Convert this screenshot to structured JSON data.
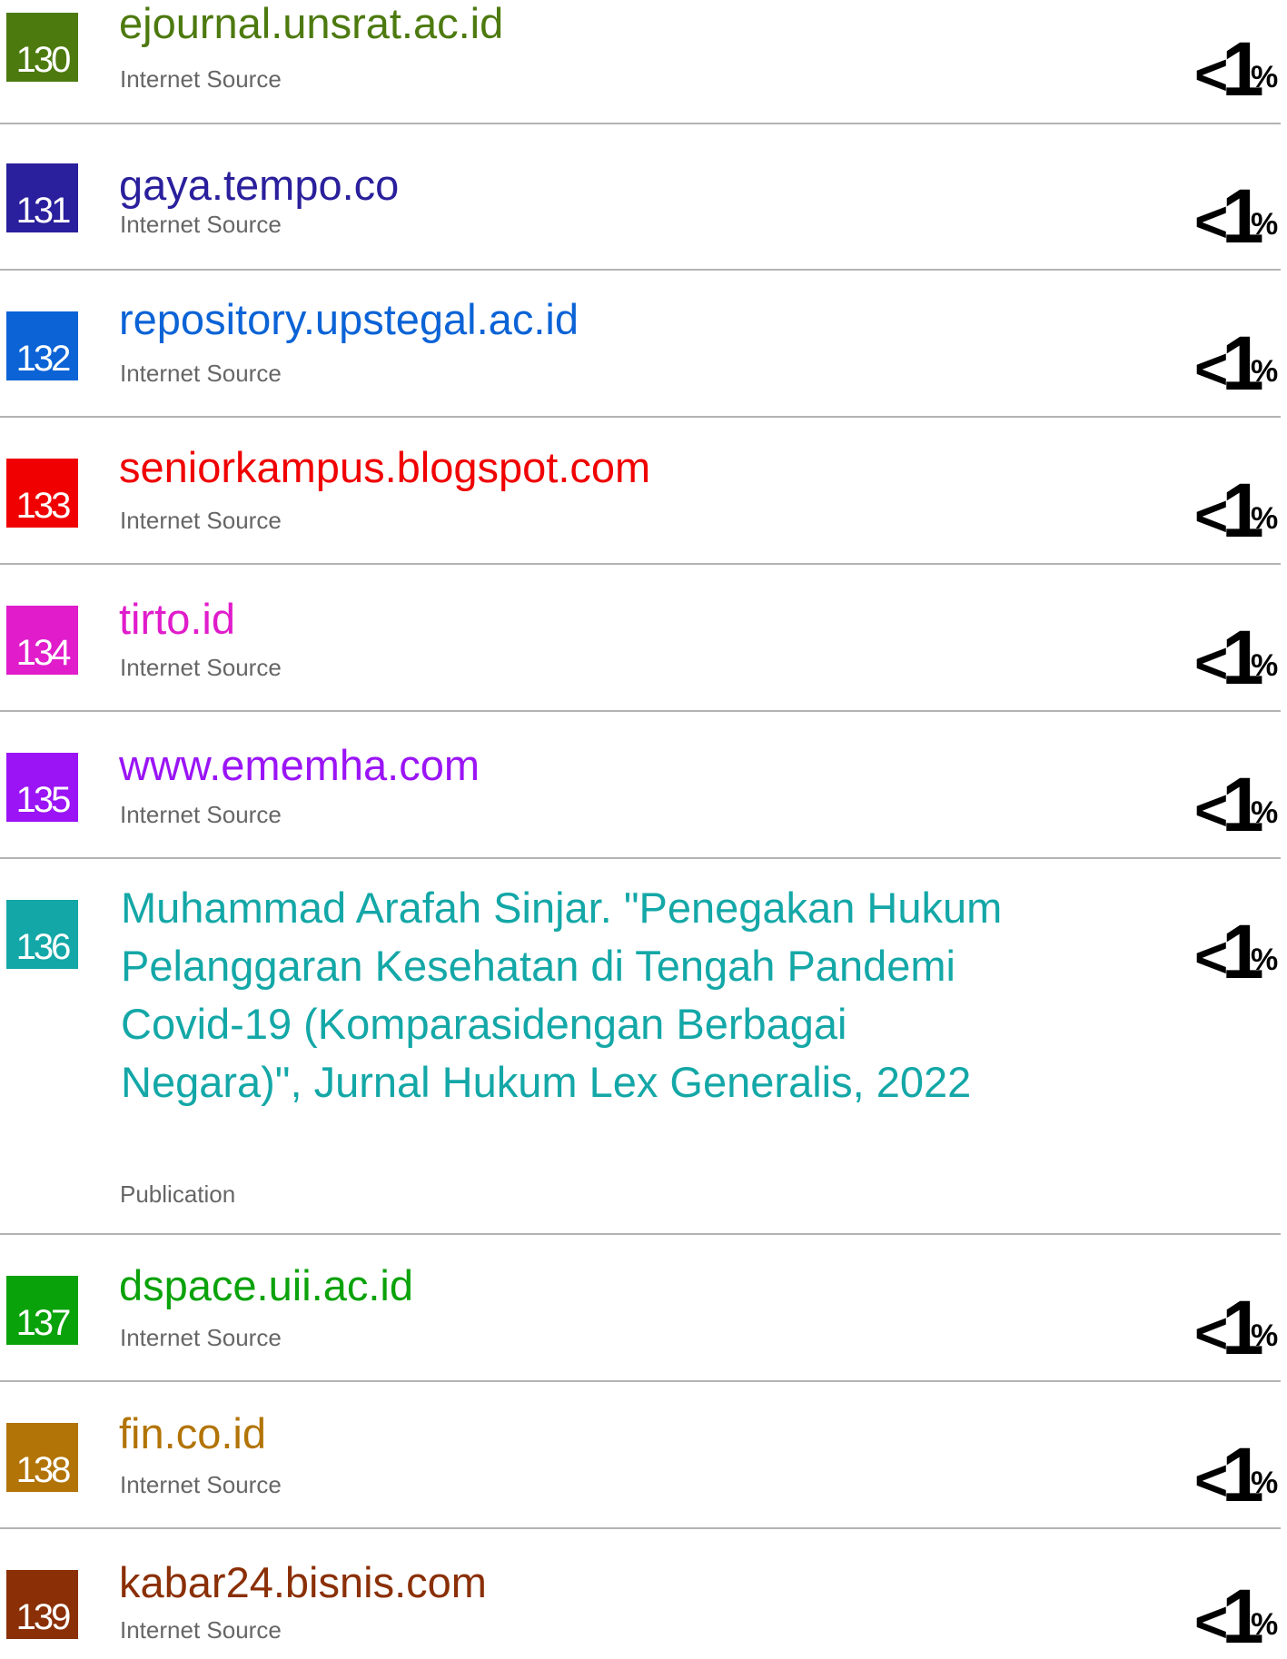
{
  "sources": [
    {
      "number": "130",
      "title": "ejournal.unsrat.ac.id",
      "type": "Internet Source",
      "color": "#4d7a0f",
      "percent": {
        "lt": "<",
        "value": "1",
        "unit": "%"
      }
    },
    {
      "number": "131",
      "title": "gaya.tempo.co",
      "type": "Internet Source",
      "color": "#2a1f9c",
      "percent": {
        "lt": "<",
        "value": "1",
        "unit": "%"
      }
    },
    {
      "number": "132",
      "title": "repository.upstegal.ac.id",
      "type": "Internet Source",
      "color": "#0b63d6",
      "percent": {
        "lt": "<",
        "value": "1",
        "unit": "%"
      }
    },
    {
      "number": "133",
      "title": "seniorkampus.blogspot.com",
      "type": "Internet Source",
      "color": "#f00000",
      "percent": {
        "lt": "<",
        "value": "1",
        "unit": "%"
      }
    },
    {
      "number": "134",
      "title": "tirto.id",
      "type": "Internet Source",
      "color": "#e01ccb",
      "percent": {
        "lt": "<",
        "value": "1",
        "unit": "%"
      }
    },
    {
      "number": "135",
      "title": "www.ememha.com",
      "type": "Internet Source",
      "color": "#9a14f5",
      "percent": {
        "lt": "<",
        "value": "1",
        "unit": "%"
      }
    },
    {
      "number": "136",
      "title": "Muhammad Arafah Sinjar. \"Penegakan Hukum Pelanggaran Kesehatan di Tengah Pandemi Covid-19 (Komparasidengan Berbagai Negara)\", Jurnal Hukum Lex Generalis, 2022",
      "type": "Publication",
      "color": "#14a7a7",
      "percent": {
        "lt": "<",
        "value": "1",
        "unit": "%"
      }
    },
    {
      "number": "137",
      "title": "dspace.uii.ac.id",
      "type": "Internet Source",
      "color": "#0aa20a",
      "percent": {
        "lt": "<",
        "value": "1",
        "unit": "%"
      }
    },
    {
      "number": "138",
      "title": "fin.co.id",
      "type": "Internet Source",
      "color": "#b27406",
      "percent": {
        "lt": "<",
        "value": "1",
        "unit": "%"
      }
    },
    {
      "number": "139",
      "title": "kabar24.bisnis.com",
      "type": "Internet Source",
      "color": "#8a2f06",
      "percent": {
        "lt": "<",
        "value": "1",
        "unit": "%"
      }
    }
  ]
}
